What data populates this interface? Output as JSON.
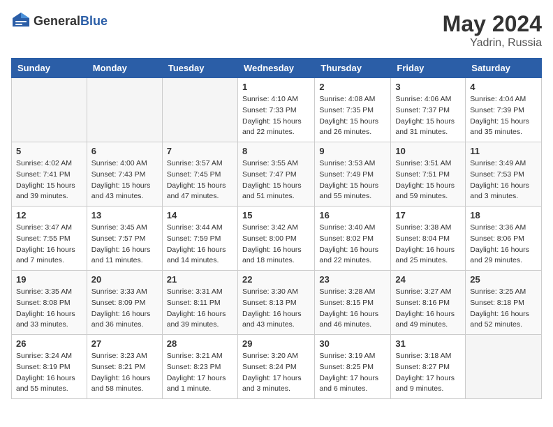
{
  "header": {
    "logo_general": "General",
    "logo_blue": "Blue",
    "title": "May 2024",
    "location": "Yadrin, Russia"
  },
  "days_of_week": [
    "Sunday",
    "Monday",
    "Tuesday",
    "Wednesday",
    "Thursday",
    "Friday",
    "Saturday"
  ],
  "weeks": [
    [
      {
        "day": "",
        "info": ""
      },
      {
        "day": "",
        "info": ""
      },
      {
        "day": "",
        "info": ""
      },
      {
        "day": "1",
        "info": "Sunrise: 4:10 AM\nSunset: 7:33 PM\nDaylight: 15 hours\nand 22 minutes."
      },
      {
        "day": "2",
        "info": "Sunrise: 4:08 AM\nSunset: 7:35 PM\nDaylight: 15 hours\nand 26 minutes."
      },
      {
        "day": "3",
        "info": "Sunrise: 4:06 AM\nSunset: 7:37 PM\nDaylight: 15 hours\nand 31 minutes."
      },
      {
        "day": "4",
        "info": "Sunrise: 4:04 AM\nSunset: 7:39 PM\nDaylight: 15 hours\nand 35 minutes."
      }
    ],
    [
      {
        "day": "5",
        "info": "Sunrise: 4:02 AM\nSunset: 7:41 PM\nDaylight: 15 hours\nand 39 minutes."
      },
      {
        "day": "6",
        "info": "Sunrise: 4:00 AM\nSunset: 7:43 PM\nDaylight: 15 hours\nand 43 minutes."
      },
      {
        "day": "7",
        "info": "Sunrise: 3:57 AM\nSunset: 7:45 PM\nDaylight: 15 hours\nand 47 minutes."
      },
      {
        "day": "8",
        "info": "Sunrise: 3:55 AM\nSunset: 7:47 PM\nDaylight: 15 hours\nand 51 minutes."
      },
      {
        "day": "9",
        "info": "Sunrise: 3:53 AM\nSunset: 7:49 PM\nDaylight: 15 hours\nand 55 minutes."
      },
      {
        "day": "10",
        "info": "Sunrise: 3:51 AM\nSunset: 7:51 PM\nDaylight: 15 hours\nand 59 minutes."
      },
      {
        "day": "11",
        "info": "Sunrise: 3:49 AM\nSunset: 7:53 PM\nDaylight: 16 hours\nand 3 minutes."
      }
    ],
    [
      {
        "day": "12",
        "info": "Sunrise: 3:47 AM\nSunset: 7:55 PM\nDaylight: 16 hours\nand 7 minutes."
      },
      {
        "day": "13",
        "info": "Sunrise: 3:45 AM\nSunset: 7:57 PM\nDaylight: 16 hours\nand 11 minutes."
      },
      {
        "day": "14",
        "info": "Sunrise: 3:44 AM\nSunset: 7:59 PM\nDaylight: 16 hours\nand 14 minutes."
      },
      {
        "day": "15",
        "info": "Sunrise: 3:42 AM\nSunset: 8:00 PM\nDaylight: 16 hours\nand 18 minutes."
      },
      {
        "day": "16",
        "info": "Sunrise: 3:40 AM\nSunset: 8:02 PM\nDaylight: 16 hours\nand 22 minutes."
      },
      {
        "day": "17",
        "info": "Sunrise: 3:38 AM\nSunset: 8:04 PM\nDaylight: 16 hours\nand 25 minutes."
      },
      {
        "day": "18",
        "info": "Sunrise: 3:36 AM\nSunset: 8:06 PM\nDaylight: 16 hours\nand 29 minutes."
      }
    ],
    [
      {
        "day": "19",
        "info": "Sunrise: 3:35 AM\nSunset: 8:08 PM\nDaylight: 16 hours\nand 33 minutes."
      },
      {
        "day": "20",
        "info": "Sunrise: 3:33 AM\nSunset: 8:09 PM\nDaylight: 16 hours\nand 36 minutes."
      },
      {
        "day": "21",
        "info": "Sunrise: 3:31 AM\nSunset: 8:11 PM\nDaylight: 16 hours\nand 39 minutes."
      },
      {
        "day": "22",
        "info": "Sunrise: 3:30 AM\nSunset: 8:13 PM\nDaylight: 16 hours\nand 43 minutes."
      },
      {
        "day": "23",
        "info": "Sunrise: 3:28 AM\nSunset: 8:15 PM\nDaylight: 16 hours\nand 46 minutes."
      },
      {
        "day": "24",
        "info": "Sunrise: 3:27 AM\nSunset: 8:16 PM\nDaylight: 16 hours\nand 49 minutes."
      },
      {
        "day": "25",
        "info": "Sunrise: 3:25 AM\nSunset: 8:18 PM\nDaylight: 16 hours\nand 52 minutes."
      }
    ],
    [
      {
        "day": "26",
        "info": "Sunrise: 3:24 AM\nSunset: 8:19 PM\nDaylight: 16 hours\nand 55 minutes."
      },
      {
        "day": "27",
        "info": "Sunrise: 3:23 AM\nSunset: 8:21 PM\nDaylight: 16 hours\nand 58 minutes."
      },
      {
        "day": "28",
        "info": "Sunrise: 3:21 AM\nSunset: 8:23 PM\nDaylight: 17 hours\nand 1 minute."
      },
      {
        "day": "29",
        "info": "Sunrise: 3:20 AM\nSunset: 8:24 PM\nDaylight: 17 hours\nand 3 minutes."
      },
      {
        "day": "30",
        "info": "Sunrise: 3:19 AM\nSunset: 8:25 PM\nDaylight: 17 hours\nand 6 minutes."
      },
      {
        "day": "31",
        "info": "Sunrise: 3:18 AM\nSunset: 8:27 PM\nDaylight: 17 hours\nand 9 minutes."
      },
      {
        "day": "",
        "info": ""
      }
    ]
  ]
}
